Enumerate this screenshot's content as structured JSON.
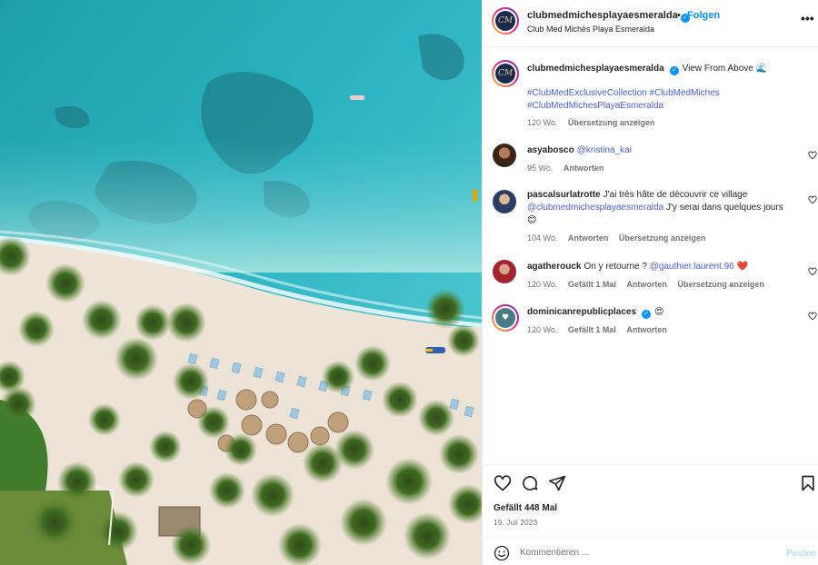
{
  "photo": {
    "alt": ""
  },
  "header": {
    "username": "clubmedmichesplayaesmeralda",
    "separator": "•",
    "follow_label": "Folgen",
    "subtitle": "Club Med Michès Playa Esmeralda",
    "avatar_text": "CM",
    "more_icon": "more-horizontal-icon"
  },
  "caption": {
    "username": "clubmedmichesplayaesmeralda",
    "text": "View From Above 🌊",
    "hashtags_line1": "#ClubMedExclusiveCollection #ClubMedMiches",
    "hashtags_line2": "#ClubMedMichesPlayaEsmeralda",
    "time": "120 Wo.",
    "translate": "Übersetzung anzeigen"
  },
  "comments": [
    {
      "username": "asyabosco",
      "mention": "@kristina_kai",
      "text": "",
      "time": "95 Wo.",
      "likes": "",
      "reply": "Antworten",
      "translate": ""
    },
    {
      "username": "pascalsurlatrotte",
      "text_before": "J'ai très hâte de découvrir ce village",
      "mention": "@clubmedmichesplayaesmeralda",
      "text_after": "J'y serai dans quelques jours",
      "emoji": "😊",
      "time": "104 Wo.",
      "reply": "Antworten",
      "translate": "Übersetzung anzeigen"
    },
    {
      "username": "agatherouck",
      "text": "On y retourne ?",
      "mention": "@gauthier.laurent.96",
      "emoji": "❤️",
      "time": "120 Wo.",
      "likes": "Gefällt 1 Mal",
      "reply": "Antworten",
      "translate": "Übersetzung anzeigen"
    },
    {
      "username": "dominicanrepublicplaces",
      "emoji": "😍",
      "time": "120 Wo.",
      "likes": "Gefällt 1 Mal",
      "reply": "Antworten"
    }
  ],
  "actions": {
    "likes": "Gefällt 448 Mal",
    "date": "19. Juli 2023"
  },
  "composer": {
    "placeholder": "Kommentieren ...",
    "post_label": "Posten"
  },
  "colors": {
    "accent": "#0095f6",
    "link": "#4a5fd6",
    "muted": "#737373",
    "post_disabled": "#b2dffc"
  }
}
